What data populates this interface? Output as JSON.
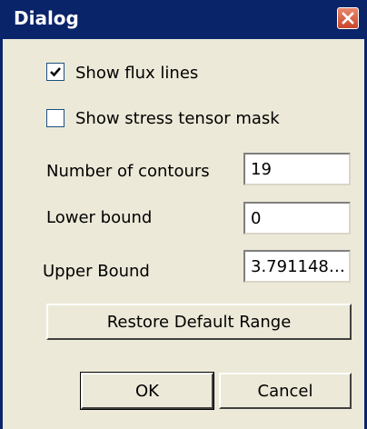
{
  "window": {
    "title": "Dialog",
    "close_icon": "close-icon"
  },
  "options": {
    "show_flux_lines": {
      "label": "Show flux lines",
      "checked": true
    },
    "show_stress_mask": {
      "label": "Show stress tensor mask",
      "checked": false
    }
  },
  "fields": {
    "contours": {
      "label": "Number of contours",
      "value": "19"
    },
    "lower_bound": {
      "label": "Lower bound",
      "value": "0"
    },
    "upper_bound": {
      "label": "Upper Bound",
      "value": "3.791148…"
    }
  },
  "buttons": {
    "restore": "Restore Default Range",
    "ok": "OK",
    "cancel": "Cancel"
  }
}
